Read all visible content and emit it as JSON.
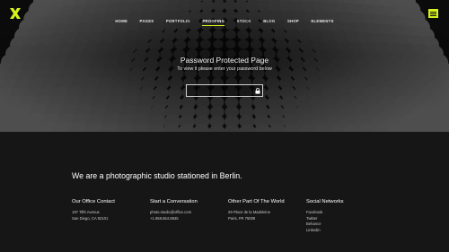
{
  "brand": {
    "accent": "#d6f21c",
    "logo_icon": "x-cross-icon"
  },
  "nav": {
    "items": [
      {
        "label": "HOME"
      },
      {
        "label": "PAGES"
      },
      {
        "label": "PORTFOLIO"
      },
      {
        "label": "PROOFING",
        "active": true
      },
      {
        "label": "STOCK"
      },
      {
        "label": "BLOG"
      },
      {
        "label": "SHOP"
      },
      {
        "label": "ELEMENTS"
      }
    ],
    "menu_icon": "hamburger-icon"
  },
  "protected": {
    "title": "Password Protected Page",
    "subtitle": "To view it please enter your password below",
    "password_value": "",
    "submit_icon": "lock-icon"
  },
  "footer": {
    "tagline": "We are a photographic studio stationed in Berlin.",
    "columns": [
      {
        "title": "Our Office Contact",
        "lines": [
          "197 Tilth Avenue",
          "San Diego, CA 92101"
        ]
      },
      {
        "title": "Start a Conversation",
        "lines": [
          "photo.studio@office.com",
          "+1.958.654.8845"
        ]
      },
      {
        "title": "Other Part Of The World",
        "lines": [
          "29 Place de la Madeleine",
          "Paris, FR 75009"
        ]
      },
      {
        "title": "Social Networks",
        "lines": [
          "Facebook",
          "Twitter",
          "Behance",
          "Linkedin"
        ]
      }
    ]
  }
}
